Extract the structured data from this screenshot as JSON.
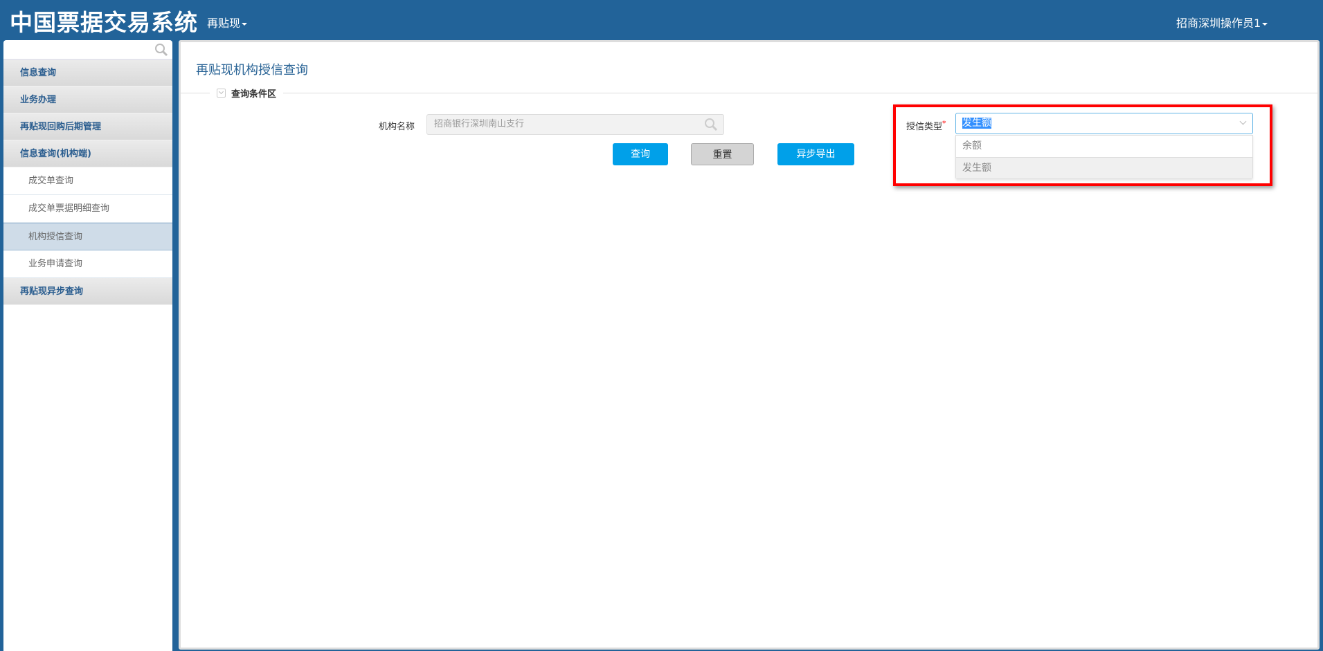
{
  "header": {
    "brand": "中国票据交易系统",
    "menu": "再贴现",
    "user": "招商深圳操作员1"
  },
  "sidebar": {
    "search_placeholder": "",
    "items": [
      {
        "label": "信息查询",
        "type": "group"
      },
      {
        "label": "业务办理",
        "type": "group"
      },
      {
        "label": "再贴现回购后期管理",
        "type": "group"
      },
      {
        "label": "信息查询(机构端)",
        "type": "group"
      },
      {
        "label": "成交单查询",
        "type": "sub"
      },
      {
        "label": "成交单票据明细查询",
        "type": "sub"
      },
      {
        "label": "机构授信查询",
        "type": "sub",
        "active": true
      },
      {
        "label": "业务申请查询",
        "type": "sub"
      },
      {
        "label": "再贴现异步查询",
        "type": "group"
      }
    ]
  },
  "main": {
    "title": "再贴现机构授信查询",
    "legend": "查询条件区",
    "inst_label": "机构名称",
    "inst_value": "招商银行深圳南山支行",
    "credit_label": "授信类型",
    "required_mark": "*",
    "credit_value": "发生额",
    "options": [
      "余额",
      "发生额"
    ],
    "buttons": {
      "query": "查询",
      "reset": "重置",
      "export": "异步导出"
    }
  }
}
